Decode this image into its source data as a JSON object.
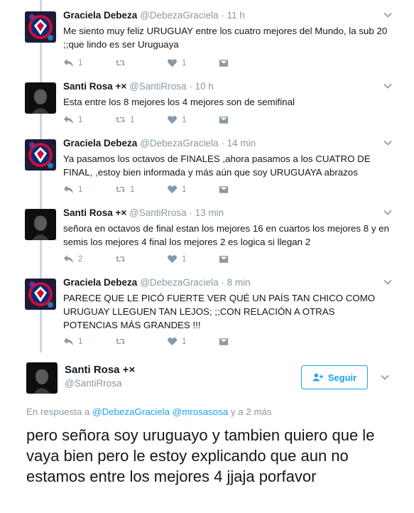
{
  "replies": [
    {
      "name": "Graciela Debeza",
      "handle": "@DebezaGraciela",
      "time": "11 h",
      "text": "Me siento muy feliz URUGUAY entre los cuatro mejores del Mundo, la sub 20 ;;que lindo es ser Uruguaya",
      "reply_count": "1",
      "retweet_count": "",
      "like_count": "1",
      "avatar": "club-crest"
    },
    {
      "name": "Santi Rosa +×",
      "handle": "@SantiRrosa",
      "time": "10 h",
      "text": "Esta entre los 8 mejores los 4 mejores son de semifinal",
      "reply_count": "1",
      "retweet_count": "1",
      "like_count": "1",
      "avatar": "dark-portrait"
    },
    {
      "name": "Graciela Debeza",
      "handle": "@DebezaGraciela",
      "time": "14 min",
      "text": "Ya pasamos los octavos de FINALES ,ahora pasamos a los CUATRO DE FINAL, ,estoy bien informada y más aún que soy URUGUAYA abrazos",
      "reply_count": "1",
      "retweet_count": "1",
      "like_count": "1",
      "avatar": "club-crest"
    },
    {
      "name": "Santi Rosa +×",
      "handle": "@SantiRrosa",
      "time": "13 min",
      "text": "señora en octavos de final estan los mejores 16 en cuartos los mejores 8 y en semis los mejores 4 final los mejores 2 es logica si llegan 2",
      "reply_count": "2",
      "retweet_count": "",
      "like_count": "1",
      "avatar": "dark-portrait"
    },
    {
      "name": "Graciela Debeza",
      "handle": "@DebezaGraciela",
      "time": "8 min",
      "text": "PARECE QUE LE PICÓ FUERTE VER QUÉ UN PAÍS TAN CHICO COMO URUGUAY LLEGUEN TAN LEJOS; ;;CON RELACIÓN A OTRAS POTENCIAS MÁS GRANDES !!!",
      "reply_count": "1",
      "retweet_count": "",
      "like_count": "1",
      "avatar": "club-crest"
    }
  ],
  "main_tweet": {
    "name": "Santi Rosa +×",
    "handle": "@SantiRrosa",
    "follow_label": "Seguir",
    "reply_prefix": "En respuesta a",
    "reply_user1": "@DebezaGraciela",
    "reply_user2": "@mrosasosa",
    "reply_suffix": "y a 2 más",
    "text": "pero señora soy uruguayo y tambien quiero que le vaya bien pero le estoy explicando que aun no estamos entre los mejores 4 jjaja porfavor"
  },
  "colors": {
    "accent": "#1da1f2",
    "muted": "#8899a6",
    "thread_line": "#ccd6dd"
  },
  "icons": [
    "reply-icon",
    "retweet-icon",
    "like-icon",
    "direct-message-icon",
    "chevron-down-icon",
    "follow-user-icon"
  ]
}
